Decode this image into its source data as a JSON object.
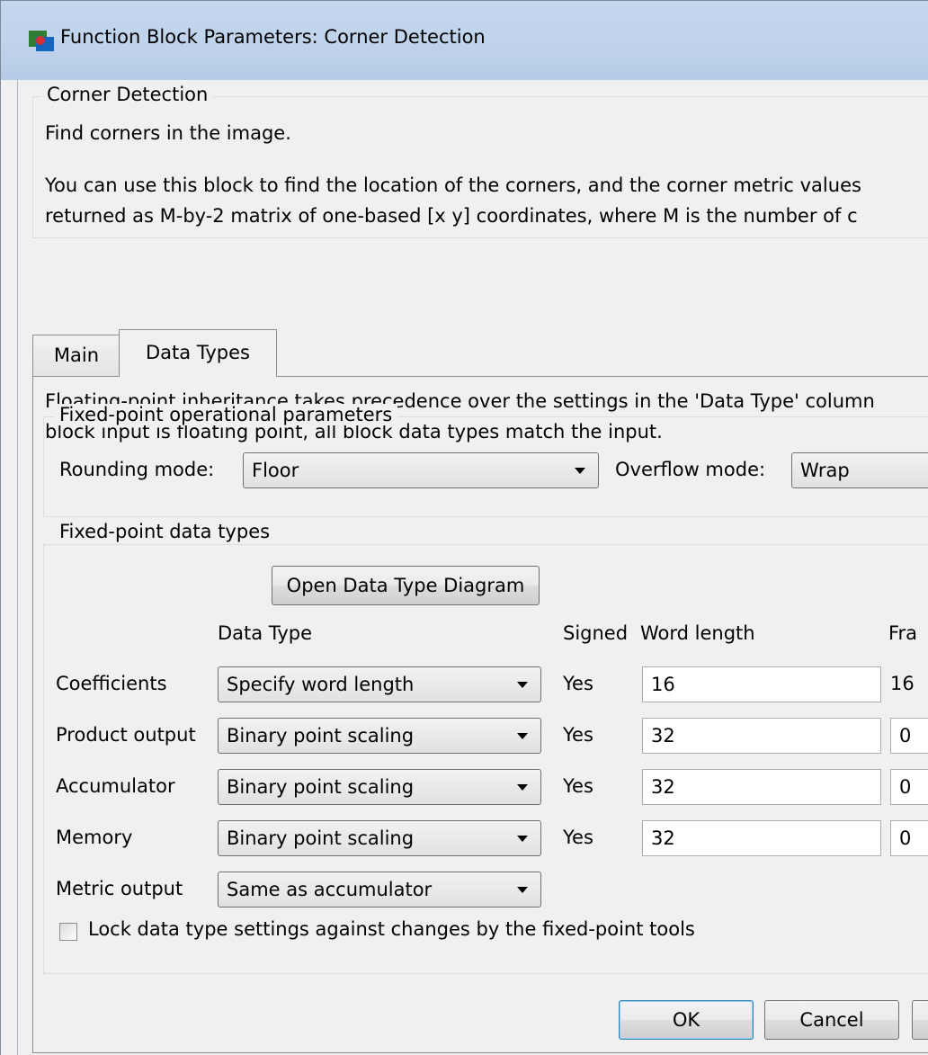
{
  "window": {
    "title": "Function Block Parameters: Corner Detection"
  },
  "description": {
    "group_title": "Corner Detection",
    "line1": "Find corners in the image.",
    "line2": "You can use this block to find the location of the corners, and the corner metric values",
    "line3": "returned as M-by-2 matrix of one-based [x y] coordinates, where M is the number of c"
  },
  "tabs": [
    {
      "label": "Main"
    },
    {
      "label": "Data Types"
    }
  ],
  "datatypes": {
    "note_line1": "Floating-point inheritance takes precedence over the settings in the 'Data Type' column",
    "note_line2": "block input is floating point, all block data types match the input.",
    "fixed_point_params": {
      "title": "Fixed-point operational parameters",
      "rounding_label": "Rounding mode:",
      "rounding_value": "Floor",
      "overflow_label": "Overflow mode:",
      "overflow_value": "Wrap"
    },
    "fixed_point_types": {
      "title": "Fixed-point data types",
      "diagram_button": "Open Data Type Diagram",
      "headers": {
        "data_type": "Data Type",
        "signed": "Signed",
        "word_length": "Word length",
        "fraction": "Fra"
      },
      "rows": [
        {
          "label": "Coefficients",
          "type": "Specify word length",
          "signed": "Yes",
          "word_length": "16",
          "fraction": "16"
        },
        {
          "label": "Product output",
          "type": "Binary point scaling",
          "signed": "Yes",
          "word_length": "32",
          "fraction": "0"
        },
        {
          "label": "Accumulator",
          "type": "Binary point scaling",
          "signed": "Yes",
          "word_length": "32",
          "fraction": "0"
        },
        {
          "label": "Memory",
          "type": "Binary point scaling",
          "signed": "Yes",
          "word_length": "32",
          "fraction": "0"
        },
        {
          "label": "Metric output",
          "type": "Same as accumulator"
        }
      ],
      "lock_label": "Lock data type settings against changes by the fixed-point tools",
      "lock_checked": false
    }
  },
  "buttons": {
    "ok": "OK",
    "cancel": "Cancel"
  }
}
